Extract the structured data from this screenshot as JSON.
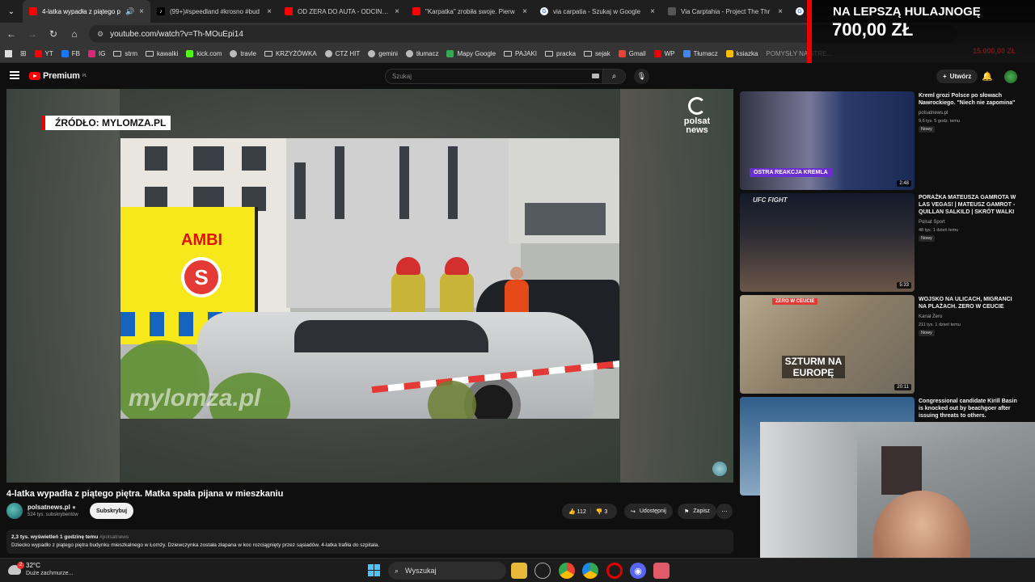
{
  "browser": {
    "tabs": [
      {
        "title": "4-latka wypadła z piątego p",
        "icon": "youtube-icon",
        "active": true,
        "audio": true
      },
      {
        "title": "(99+)#speedland #krosno #bud",
        "icon": "tiktok-icon"
      },
      {
        "title": "OD ZERA DO AUTA - ODCINEK",
        "icon": "youtube-icon"
      },
      {
        "title": "\"Karpatka\" zrobiła swoje. Pierw",
        "icon": "youtube-icon"
      },
      {
        "title": "via carpatia - Szukaj w Google",
        "icon": "google-icon"
      },
      {
        "title": "Via Carptahia - Project The Thr",
        "icon": "page-icon"
      },
      {
        "title": "",
        "icon": "google-icon"
      }
    ],
    "url": "youtube.com/watch?v=Th-MOuEpi14",
    "bookmarks": [
      {
        "label": "YT",
        "icon": "youtube-icon",
        "color": "#ff0000"
      },
      {
        "label": "FB",
        "icon": "facebook-icon",
        "color": "#1877f2"
      },
      {
        "label": "IG",
        "icon": "instagram-icon",
        "color": "#d62976"
      },
      {
        "label": "strm",
        "icon": "folder-icon"
      },
      {
        "label": "kawalki",
        "icon": "folder-icon"
      },
      {
        "label": "kick.com",
        "icon": "kick-icon",
        "color": "#53fc18"
      },
      {
        "label": "travle",
        "icon": "globe-icon"
      },
      {
        "label": "KRZYŻÓWKA",
        "icon": "folder-icon"
      },
      {
        "label": "CTZ HIT",
        "icon": "crossword-icon"
      },
      {
        "label": "gemini",
        "icon": "gemini-icon"
      },
      {
        "label": "tłumacz",
        "icon": "translate-icon"
      },
      {
        "label": "Mapy Google",
        "icon": "maps-icon",
        "color": "#34a853"
      },
      {
        "label": "PAJAKI",
        "icon": "folder-icon"
      },
      {
        "label": "pracka",
        "icon": "folder-icon"
      },
      {
        "label": "sejak",
        "icon": "folder-icon"
      },
      {
        "label": "Gmail",
        "icon": "gmail-icon",
        "color": "#ea4335"
      },
      {
        "label": "WP",
        "icon": "wp-icon",
        "color": "#e00"
      },
      {
        "label": "Tłumacz",
        "icon": "translate-icon",
        "color": "#4285f4"
      },
      {
        "label": "ksiazka",
        "icon": "apps-icon",
        "color": "#fbbc04"
      }
    ],
    "bookmarks_overflow": "POMYSŁY NA STRE..."
  },
  "youtube": {
    "logo_label": "Premium",
    "logo_region": "PL",
    "search_placeholder": "Szukaj",
    "create_label": "Utwórz"
  },
  "video": {
    "overlay_source": "ŹRÓDŁO: MYLOMZA.PL",
    "broadcaster_top": "polsat",
    "broadcaster_bottom": "news",
    "scene_watermark": "mylomza.pl",
    "ambulance_text": "AMBI",
    "ambulance_symbol": "S",
    "title": "4-latka wypadła z piątego piętra. Matka spała pijana w mieszkaniu",
    "channel": "polsatnews.pl",
    "subscribers": "524 tys. subskrybentów",
    "subscribe_label": "Subskrybuj",
    "likes": "112",
    "dislikes": "3",
    "share_label": "Udostępnij",
    "save_label": "Zapisz",
    "views": "2,3 tys. wyświetleń",
    "age": "1 godzinę temu",
    "hashtag": "#polsatnews",
    "description": "Dziecko wypadło z piątego piętra budynku mieszkalnego w Łomży. Dziewczynka została złapana w koc rozciągnięty przez sąsiadów. 4-latka trafiła do szpitala."
  },
  "recommendations": [
    {
      "title": "Kreml grozi Polsce po słowach Nawrockiego. \"Niech nie zapomina\"",
      "channel": "polsatnews.pl",
      "meta": "9,6 tys.  5 godz. temu",
      "badge": "Nowy",
      "duration": "2:48",
      "thumb_caption": "OSTRA REAKCJA KREMLA"
    },
    {
      "title": "PORAŻKA MATEUSZA GAMROTA W LAS VEGAS! | MATEUSZ GAMROT - QUILLAN SALKILD | SKRÓT WALKI",
      "channel": "Polsat Sport",
      "meta": "48 tys.  1 dzień temu",
      "badge": "Nowy",
      "duration": "5:33",
      "thumb_caption": "UFC FIGHT"
    },
    {
      "title": "WOJSKO NA ULICACH, MIGRANCI NA PLAŻACH. ZERO W CEUCIE",
      "channel": "Kanał Zero",
      "meta": "211 tys.  1 dzień temu",
      "badge": "Nowy",
      "duration": "20:11",
      "thumb_caption": "SZTURM NA EUROPĘ",
      "thumb_tag": "ZERO W CEUCIE"
    },
    {
      "title": "Congressional candidate Kirill Basin is knocked out by beachgoer after issuing threats to others.",
      "channel": "",
      "meta": "",
      "badge": "",
      "duration": "",
      "thumb_caption": ""
    }
  ],
  "stream_overlay": {
    "line1": "NA LEPSZĄ HULAJNOGĘ",
    "line2": "700,00 ZŁ",
    "faded": "15.000,00 ZŁ"
  },
  "taskbar": {
    "temperature": "32°C",
    "condition": "Duże zachmurze...",
    "notification_count": "2",
    "search_label": "Wyszukaj",
    "apps": [
      "file-explorer-icon",
      "chatgpt-icon",
      "chrome-icon",
      "chrome-beta-icon",
      "opera-icon",
      "discord-icon",
      "streamlabs-icon"
    ]
  }
}
